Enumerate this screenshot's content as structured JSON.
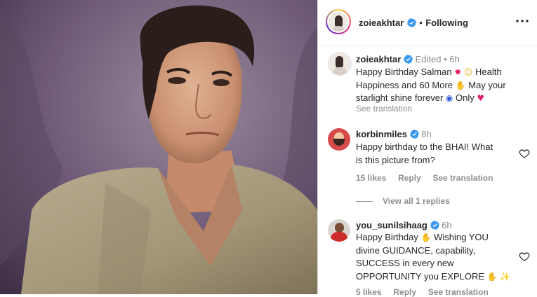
{
  "header": {
    "username": "zoieakhtar",
    "separator": "•",
    "follow_status": "Following"
  },
  "caption": {
    "username": "zoieakhtar",
    "edited": "Edited",
    "dot": "•",
    "time": "6h",
    "text_1": "Happy Birthday Salman",
    "text_2": "Health",
    "text_3": "Happiness and 60 More",
    "text_4": "May your",
    "text_5": "starlight shine forever",
    "text_6": "Only",
    "see_translation": "See translation"
  },
  "comments": [
    {
      "username": "korbinmiles",
      "time": "8h",
      "line1": "Happy birthday to the BHAI! What",
      "line2": "is this picture from?",
      "likes": "15 likes",
      "reply": "Reply",
      "see_translation": "See translation",
      "view_replies": "View all 1 replies"
    },
    {
      "username": "you_sunilsihaag",
      "time": "6h",
      "line1": "Happy Birthday",
      "line1b": "Wishing YOU",
      "line2": "divine GUIDANCE, capability,",
      "line3": "SUCCESS in every new",
      "line4": "OPPORTUNITY you EXPLORE",
      "likes": "5 likes",
      "reply": "Reply",
      "see_translation": "See translation"
    }
  ],
  "colors": {
    "verified_blue": "#3897f0",
    "muted": "#8e8e8e",
    "photo_background": "#6e5a78"
  }
}
